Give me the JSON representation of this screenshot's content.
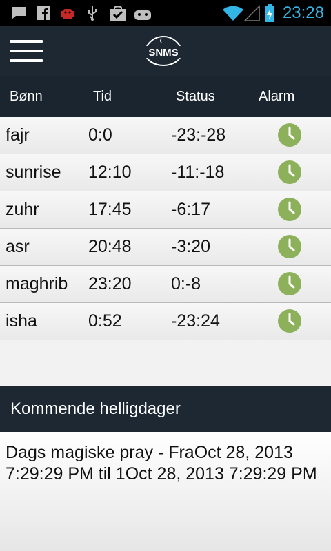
{
  "status_bar": {
    "time": "23:28",
    "icons": [
      "chat-icon",
      "facebook-icon",
      "android-bug-icon",
      "usb-icon",
      "shopping-bag-icon",
      "android-game-icon",
      "wifi-icon",
      "signal-icon",
      "battery-charging-icon"
    ]
  },
  "header": {
    "logo_text": "SNMS"
  },
  "columns": {
    "prayer": "Bønn",
    "time": "Tid",
    "status": "Status",
    "alarm": "Alarm"
  },
  "prayers": [
    {
      "name": "fajr",
      "time": "0:0",
      "status": "-23:-28"
    },
    {
      "name": "sunrise",
      "time": "12:10",
      "status": "-11:-18"
    },
    {
      "name": "zuhr",
      "time": "17:45",
      "status": "-6:17"
    },
    {
      "name": "asr",
      "time": "20:48",
      "status": "-3:20"
    },
    {
      "name": "maghrib",
      "time": "23:20",
      "status": "0:-8"
    },
    {
      "name": "isha",
      "time": "0:52",
      "status": "-23:24"
    }
  ],
  "holidays": {
    "title": "Kommende helligdager",
    "text": "Dags magiske pray - FraOct 28, 2013 7:29:29 PM til 1Oct 28, 2013 7:29:29 PM"
  },
  "colors": {
    "accent": "#33b5e5",
    "action_bar": "#1d2833",
    "alarm_green": "#8db05b"
  }
}
